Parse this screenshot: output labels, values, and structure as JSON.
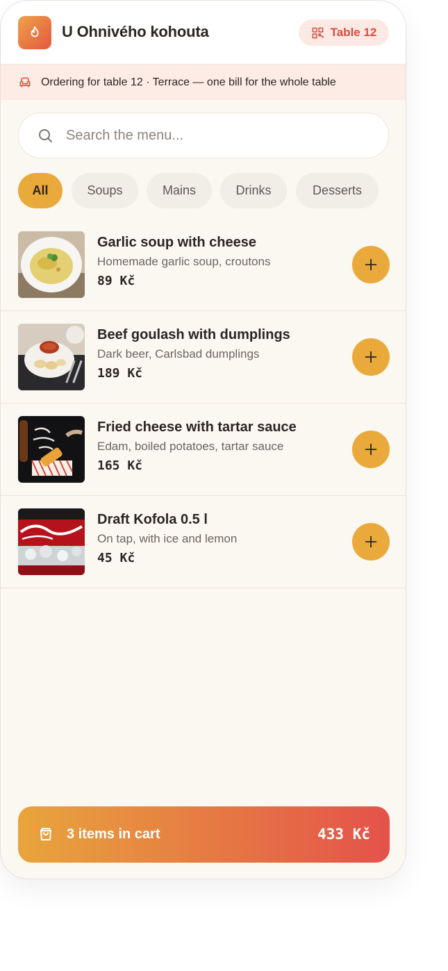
{
  "header": {
    "restaurant_name": "U Ohnivého kohouta",
    "table_badge": "Table 12"
  },
  "notice": {
    "text": "Ordering for table 12 · Terrace — one bill for the whole table"
  },
  "search": {
    "placeholder": "Search the menu..."
  },
  "categories": [
    {
      "label": "All",
      "active": true
    },
    {
      "label": "Soups",
      "active": false
    },
    {
      "label": "Mains",
      "active": false
    },
    {
      "label": "Drinks",
      "active": false
    },
    {
      "label": "Desserts",
      "active": false
    }
  ],
  "menu": [
    {
      "name": "Garlic soup with cheese",
      "description": "Homemade garlic soup, croutons",
      "price": "89 Kč",
      "image": "garlic-soup-photo"
    },
    {
      "name": "Beef goulash with dumplings",
      "description": "Dark beer, Carlsbad dumplings",
      "price": "189 Kč",
      "image": "goulash-photo"
    },
    {
      "name": "Fried cheese with tartar sauce",
      "description": "Edam, boiled potatoes, tartar sauce",
      "price": "165 Kč",
      "image": "fried-cheese-photo"
    },
    {
      "name": "Draft Kofola 0.5 l",
      "description": "On tap, with ice and lemon",
      "price": "45 Kč",
      "image": "kofola-photo"
    }
  ],
  "cart": {
    "label": "3 items in cart",
    "total": "433 Kč"
  },
  "colors": {
    "accent": "#e9a93b",
    "brand_red": "#e2573e",
    "background": "#fbf7f1",
    "notice_bg": "#fdebe5"
  }
}
